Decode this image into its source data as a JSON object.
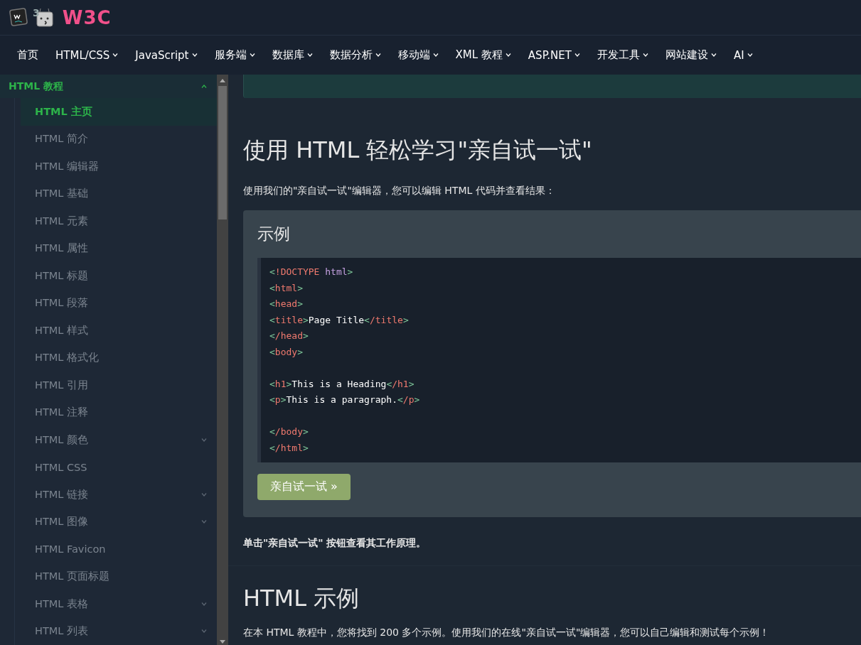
{
  "header": {
    "logo_mark": "3",
    "logo_text": "W3C"
  },
  "nav": [
    {
      "label": "首页",
      "dropdown": false
    },
    {
      "label": "HTML/CSS",
      "dropdown": true
    },
    {
      "label": "JavaScript",
      "dropdown": true
    },
    {
      "label": "服务端",
      "dropdown": true
    },
    {
      "label": "数据库",
      "dropdown": true
    },
    {
      "label": "数据分析",
      "dropdown": true
    },
    {
      "label": "移动端",
      "dropdown": true
    },
    {
      "label": "XML 教程",
      "dropdown": true
    },
    {
      "label": "ASP.NET",
      "dropdown": true
    },
    {
      "label": "开发工具",
      "dropdown": true
    },
    {
      "label": "网站建设",
      "dropdown": true
    },
    {
      "label": "AI",
      "dropdown": true
    }
  ],
  "sidebar": {
    "section": {
      "label": "HTML 教程",
      "expanded": true
    },
    "items": [
      {
        "label": "HTML 主页",
        "selected": true,
        "has_children": false
      },
      {
        "label": "HTML 简介",
        "selected": false,
        "has_children": false
      },
      {
        "label": "HTML 编辑器",
        "selected": false,
        "has_children": false
      },
      {
        "label": "HTML 基础",
        "selected": false,
        "has_children": false
      },
      {
        "label": "HTML 元素",
        "selected": false,
        "has_children": false
      },
      {
        "label": "HTML 属性",
        "selected": false,
        "has_children": false
      },
      {
        "label": "HTML 标题",
        "selected": false,
        "has_children": false
      },
      {
        "label": "HTML 段落",
        "selected": false,
        "has_children": false
      },
      {
        "label": "HTML 样式",
        "selected": false,
        "has_children": false
      },
      {
        "label": "HTML 格式化",
        "selected": false,
        "has_children": false
      },
      {
        "label": "HTML 引用",
        "selected": false,
        "has_children": false
      },
      {
        "label": "HTML 注释",
        "selected": false,
        "has_children": false
      },
      {
        "label": "HTML 颜色",
        "selected": false,
        "has_children": true
      },
      {
        "label": "HTML CSS",
        "selected": false,
        "has_children": false
      },
      {
        "label": "HTML 链接",
        "selected": false,
        "has_children": true
      },
      {
        "label": "HTML 图像",
        "selected": false,
        "has_children": true
      },
      {
        "label": "HTML Favicon",
        "selected": false,
        "has_children": false
      },
      {
        "label": "HTML 页面标题",
        "selected": false,
        "has_children": false
      },
      {
        "label": "HTML 表格",
        "selected": false,
        "has_children": true
      },
      {
        "label": "HTML 列表",
        "selected": false,
        "has_children": true
      }
    ]
  },
  "content": {
    "heading": "使用 HTML 轻松学习\"亲自试一试\"",
    "intro": "使用我们的\"亲自试一试\"编辑器，您可以编辑 HTML 代码并查看结果：",
    "example": {
      "title": "示例",
      "code": [
        [
          {
            "kind": "punct",
            "text": "<"
          },
          {
            "kind": "tag",
            "text": "!DOCTYPE"
          },
          {
            "kind": "keyword",
            "text": " html"
          },
          {
            "kind": "punct",
            "text": ">"
          }
        ],
        [
          {
            "kind": "punct",
            "text": "<"
          },
          {
            "kind": "tag",
            "text": "html"
          },
          {
            "kind": "punct",
            "text": ">"
          }
        ],
        [
          {
            "kind": "punct",
            "text": "<"
          },
          {
            "kind": "tag",
            "text": "head"
          },
          {
            "kind": "punct",
            "text": ">"
          }
        ],
        [
          {
            "kind": "punct",
            "text": "<"
          },
          {
            "kind": "tag",
            "text": "title"
          },
          {
            "kind": "punct",
            "text": ">"
          },
          {
            "kind": "text",
            "text": "Page Title"
          },
          {
            "kind": "punct",
            "text": "<"
          },
          {
            "kind": "tag",
            "text": "/title"
          },
          {
            "kind": "punct",
            "text": ">"
          }
        ],
        [
          {
            "kind": "punct",
            "text": "<"
          },
          {
            "kind": "tag",
            "text": "/head"
          },
          {
            "kind": "punct",
            "text": ">"
          }
        ],
        [
          {
            "kind": "punct",
            "text": "<"
          },
          {
            "kind": "tag",
            "text": "body"
          },
          {
            "kind": "punct",
            "text": ">"
          }
        ],
        {
          "kind": "blank"
        },
        [
          {
            "kind": "punct",
            "text": "<"
          },
          {
            "kind": "tag",
            "text": "h1"
          },
          {
            "kind": "punct",
            "text": ">"
          },
          {
            "kind": "text",
            "text": "This is a Heading"
          },
          {
            "kind": "punct",
            "text": "<"
          },
          {
            "kind": "tag",
            "text": "/h1"
          },
          {
            "kind": "punct",
            "text": ">"
          }
        ],
        [
          {
            "kind": "punct",
            "text": "<"
          },
          {
            "kind": "tag",
            "text": "p"
          },
          {
            "kind": "punct",
            "text": ">"
          },
          {
            "kind": "text",
            "text": "This is a paragraph."
          },
          {
            "kind": "punct",
            "text": "<"
          },
          {
            "kind": "tag",
            "text": "/p"
          },
          {
            "kind": "punct",
            "text": ">"
          }
        ],
        {
          "kind": "blank"
        },
        [
          {
            "kind": "punct",
            "text": "<"
          },
          {
            "kind": "tag",
            "text": "/body"
          },
          {
            "kind": "punct",
            "text": ">"
          }
        ],
        [
          {
            "kind": "punct",
            "text": "<"
          },
          {
            "kind": "tag",
            "text": "/html"
          },
          {
            "kind": "punct",
            "text": ">"
          }
        ]
      ],
      "button": "亲自试一试 »"
    },
    "note": "单击\"亲自试一试\" 按钮查看其工作原理。",
    "heading2": "HTML 示例",
    "paragraph": "在本 HTML 教程中，您将找到 200 多个示例。使用我们的在线\"亲自试一试\"编辑器，您可以自己编辑和测试每个示例！"
  }
}
